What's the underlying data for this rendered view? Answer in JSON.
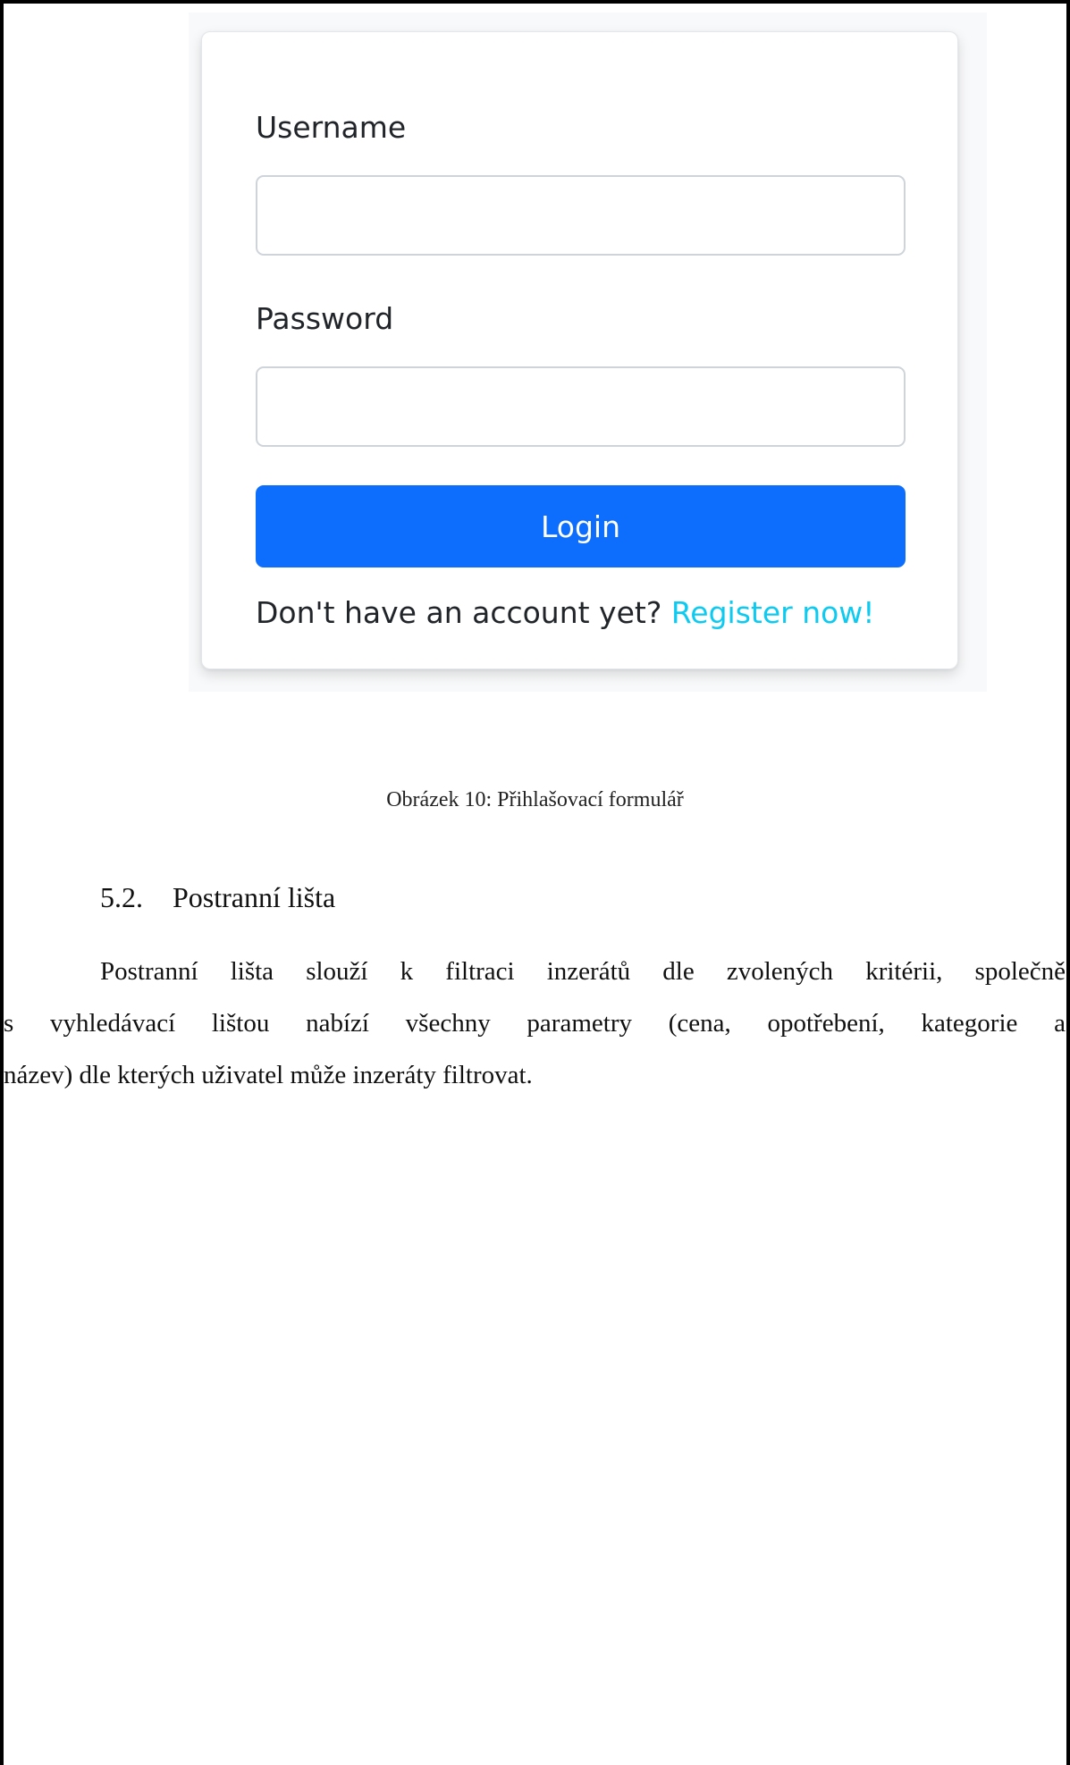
{
  "login_form": {
    "username_label": "Username",
    "username_value": "",
    "password_label": "Password",
    "password_value": "",
    "login_label": "Login",
    "signup_prompt": "Don't have an account yet? ",
    "signup_link": "Register now!",
    "colors": {
      "primary_button": "#0d6efd",
      "link": "#0dcaf0"
    }
  },
  "caption": "Obrázek 10: Přihlašovací formulář",
  "section": {
    "number": "5.2.",
    "title": "Postranní lišta"
  },
  "paragraph": {
    "lines": [
      "Postranní lišta slouží k filtraci inzerátů dle zvolených kritérii, společně",
      "s vyhledávací lištou nabízí všechny parametry (cena, opotřebení, kategorie a",
      "název) dle kterých uživatel může inzeráty filtrovat."
    ]
  }
}
